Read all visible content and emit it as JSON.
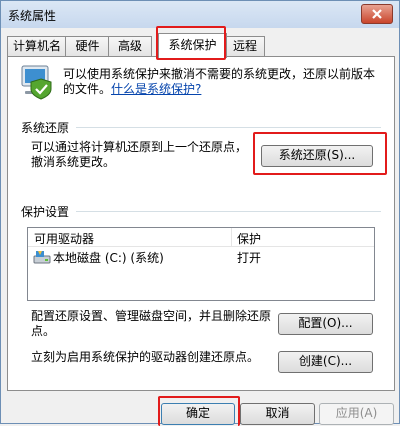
{
  "window": {
    "title": "系统属性"
  },
  "tabs": [
    {
      "label": "计算机名"
    },
    {
      "label": "硬件"
    },
    {
      "label": "高级"
    },
    {
      "label": "系统保护"
    },
    {
      "label": "远程"
    }
  ],
  "intro": {
    "text": "可以使用系统保护来撤消不需要的系统更改，还原以前版本的文件。",
    "link": "什么是系统保护?"
  },
  "restore": {
    "group_title": "系统还原",
    "description": "可以通过将计算机还原到上一个还原点，撤消系统更改。",
    "button": "系统还原(S)..."
  },
  "protection": {
    "group_title": "保护设置",
    "columns": [
      "可用驱动器",
      "保护"
    ],
    "drives": [
      {
        "name": "本地磁盘 (C:) (系统)",
        "protection": "打开"
      }
    ]
  },
  "configure": {
    "text": "配置还原设置、管理磁盘空间，并且删除还原点。",
    "button": "配置(O)..."
  },
  "create": {
    "text": "立刻为启用系统保护的驱动器创建还原点。",
    "button": "创建(C)..."
  },
  "footer": {
    "ok": "确定",
    "cancel": "取消",
    "apply": "应用(A)"
  }
}
